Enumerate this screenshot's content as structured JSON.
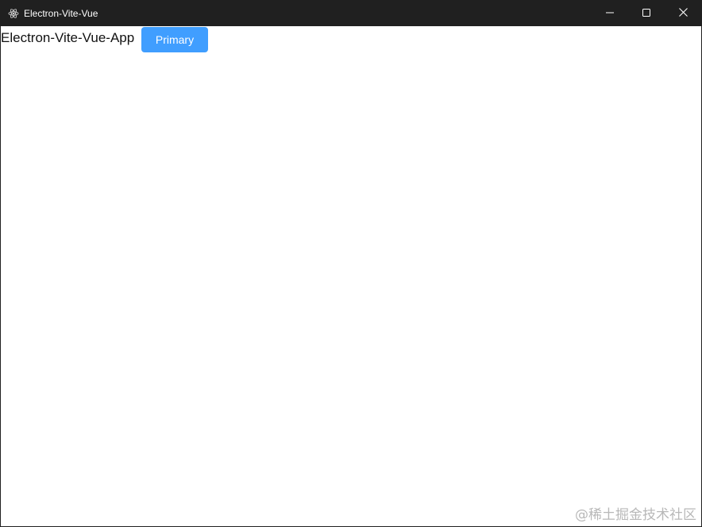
{
  "window": {
    "title": "Electron-Vite-Vue",
    "controls": {
      "minimize_icon": "minimize-icon",
      "maximize_icon": "maximize-icon",
      "close_icon": "close-icon"
    },
    "app_icon": "electron-icon"
  },
  "main": {
    "heading": "Electron-Vite-Vue-App",
    "primary_button_label": "Primary"
  },
  "watermark": "@稀土掘金技术社区",
  "colors": {
    "titlebar": "#202020",
    "primary": "#409eff",
    "background": "#ffffff"
  }
}
